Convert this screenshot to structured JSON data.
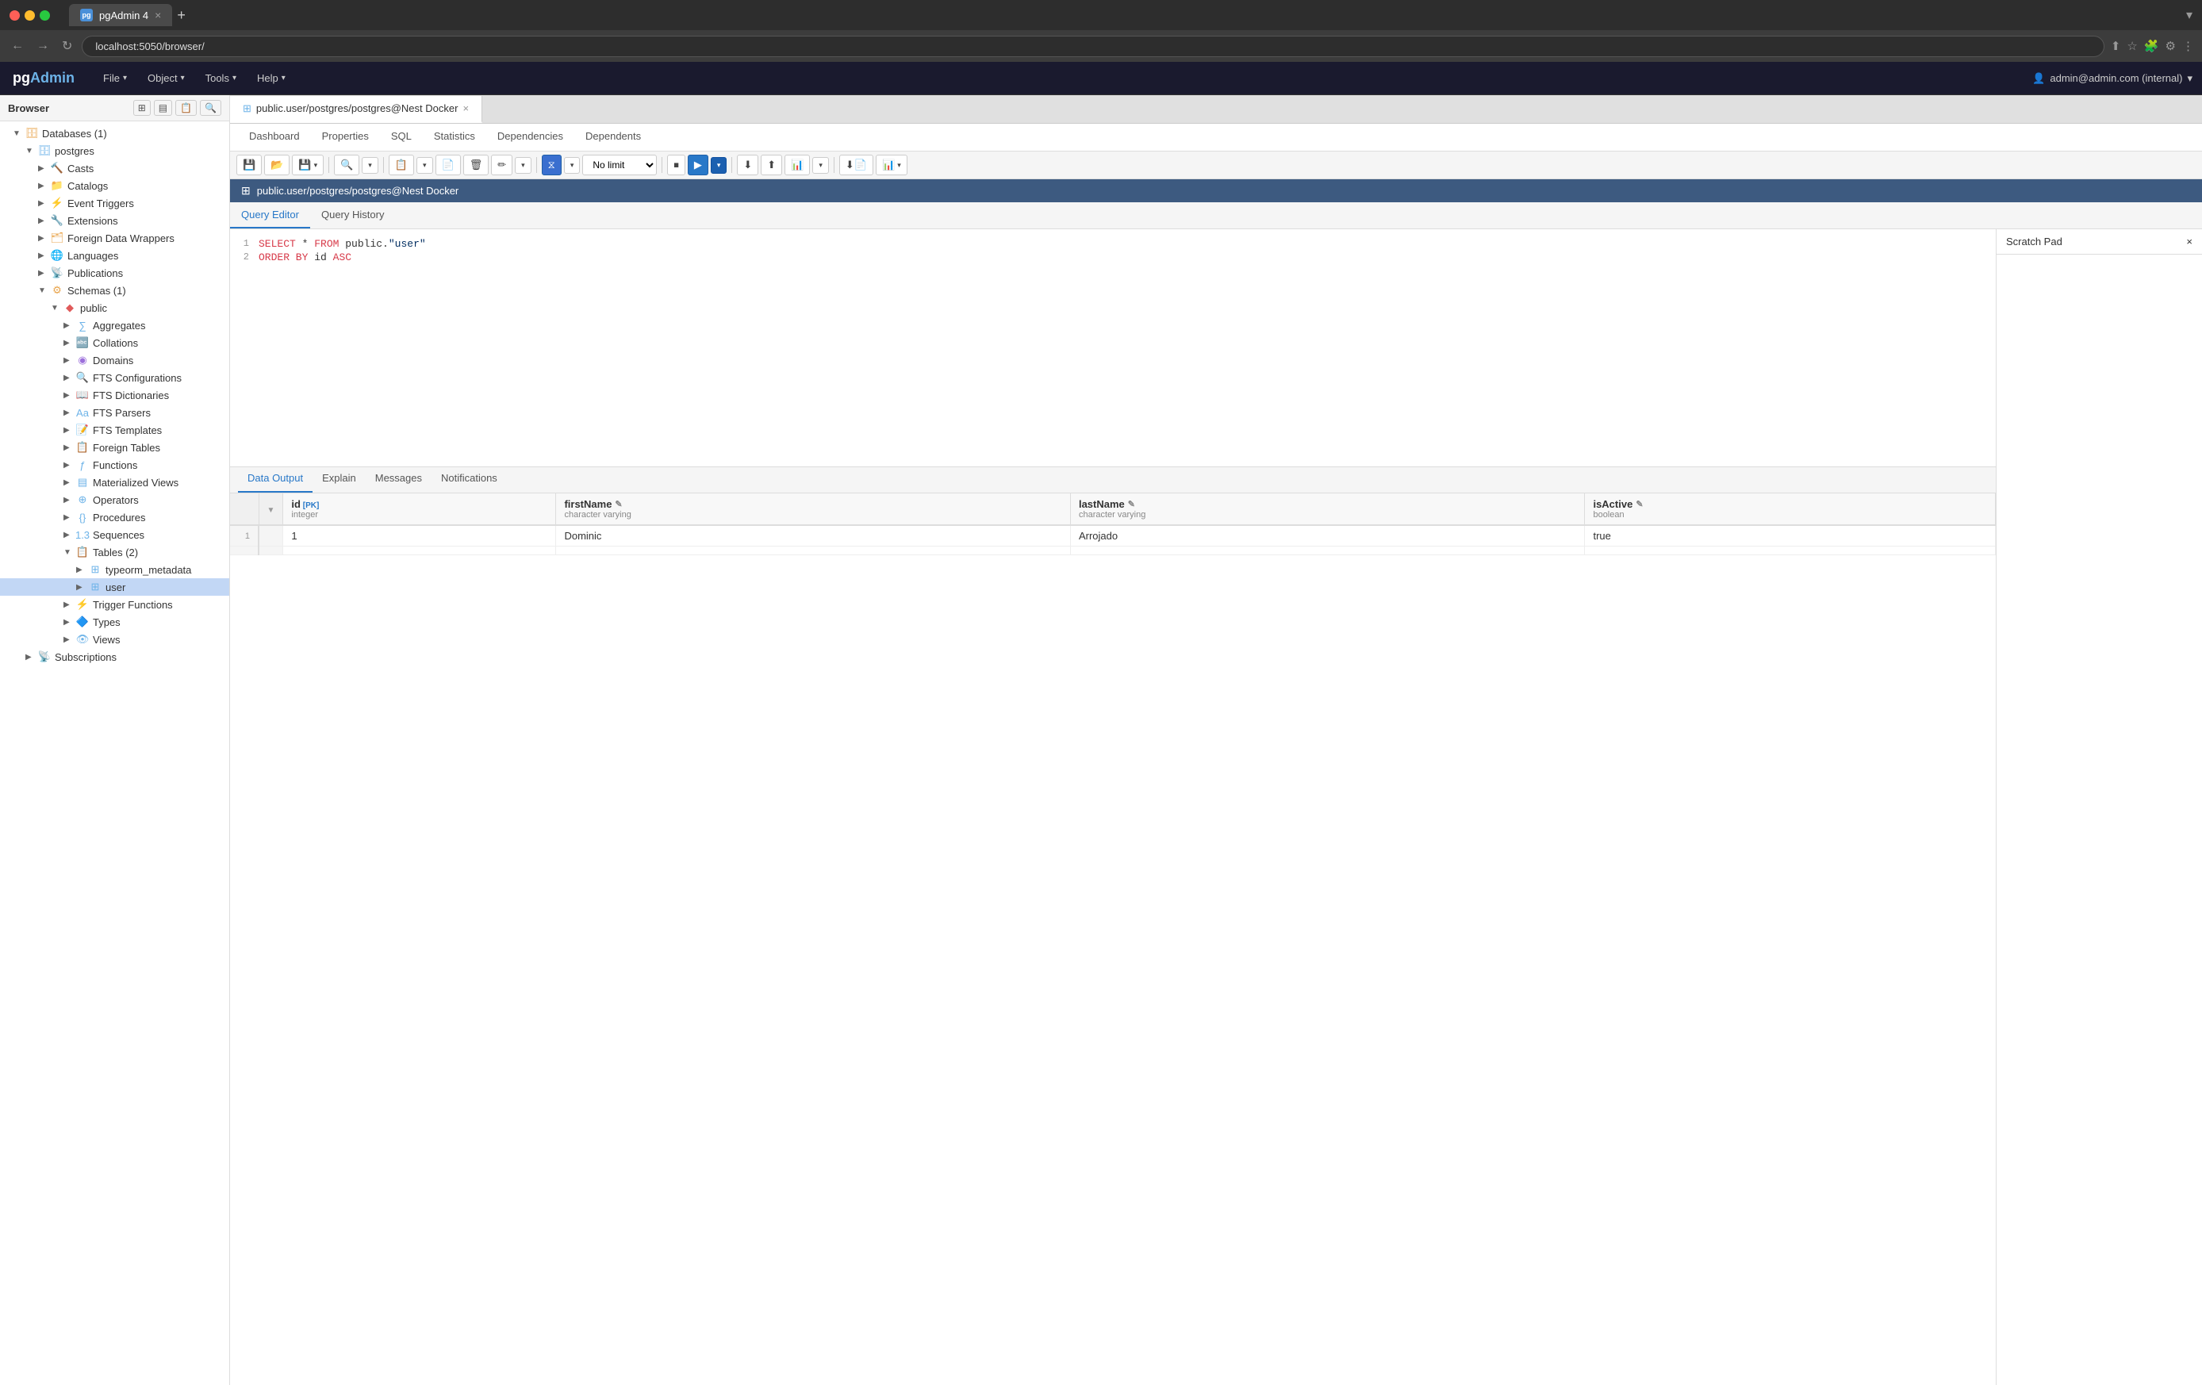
{
  "titlebar": {
    "tab_icon": "pg",
    "tab_title": "pgAdmin 4",
    "new_tab_label": "+",
    "window_controls": "▾"
  },
  "addressbar": {
    "url": "localhost:5050/browser/",
    "back": "←",
    "forward": "→",
    "refresh": "↻"
  },
  "app_header": {
    "logo": "pgAdmin",
    "menus": [
      {
        "label": "File",
        "has_arrow": true
      },
      {
        "label": "Object",
        "has_arrow": true
      },
      {
        "label": "Tools",
        "has_arrow": true
      },
      {
        "label": "Help",
        "has_arrow": true
      }
    ],
    "user": "admin@admin.com (internal)",
    "user_arrow": "▾"
  },
  "browser": {
    "title": "Browser",
    "toolbar_buttons": [
      "⊞",
      "▤",
      "📋",
      "🔍"
    ],
    "tree": [
      {
        "indent": 1,
        "toggle": "▼",
        "icon": "🗄",
        "icon_color": "#e8a44b",
        "label": "Databases (1)",
        "level": 1
      },
      {
        "indent": 2,
        "toggle": "▼",
        "icon": "🗄",
        "icon_color": "#6db3e8",
        "label": "postgres",
        "level": 2
      },
      {
        "indent": 3,
        "toggle": "▶",
        "icon": "🔨",
        "icon_color": "#e8a44b",
        "label": "Casts",
        "level": 3
      },
      {
        "indent": 3,
        "toggle": "▶",
        "icon": "📁",
        "icon_color": "#e8c860",
        "label": "Catalogs",
        "level": 3
      },
      {
        "indent": 3,
        "toggle": "▶",
        "icon": "⚡",
        "icon_color": "#9c6fdb",
        "label": "Event Triggers",
        "level": 3
      },
      {
        "indent": 3,
        "toggle": "▶",
        "icon": "🔧",
        "icon_color": "#6db3e8",
        "label": "Extensions",
        "level": 3
      },
      {
        "indent": 3,
        "toggle": "▶",
        "icon": "🗂",
        "icon_color": "#e8a44b",
        "label": "Foreign Data Wrappers",
        "level": 3
      },
      {
        "indent": 3,
        "toggle": "▶",
        "icon": "🌐",
        "icon_color": "#6db3e8",
        "label": "Languages",
        "level": 3
      },
      {
        "indent": 3,
        "toggle": "▶",
        "icon": "📡",
        "icon_color": "#6db3e8",
        "label": "Publications",
        "level": 3
      },
      {
        "indent": 3,
        "toggle": "▼",
        "icon": "⚙",
        "icon_color": "#e8a44b",
        "label": "Schemas (1)",
        "level": 3
      },
      {
        "indent": 4,
        "toggle": "▼",
        "icon": "◆",
        "icon_color": "#e05a5a",
        "label": "public",
        "level": 4
      },
      {
        "indent": 5,
        "toggle": "▶",
        "icon": "∑",
        "icon_color": "#6db3e8",
        "label": "Aggregates",
        "level": 5
      },
      {
        "indent": 5,
        "toggle": "▶",
        "icon": "🔤",
        "icon_color": "#e8a44b",
        "label": "Collations",
        "level": 5
      },
      {
        "indent": 5,
        "toggle": "▶",
        "icon": "◉",
        "icon_color": "#9c6fdb",
        "label": "Domains",
        "level": 5
      },
      {
        "indent": 5,
        "toggle": "▶",
        "icon": "🔍",
        "icon_color": "#6db3e8",
        "label": "FTS Configurations",
        "level": 5
      },
      {
        "indent": 5,
        "toggle": "▶",
        "icon": "📖",
        "icon_color": "#6db3e8",
        "label": "FTS Dictionaries",
        "level": 5
      },
      {
        "indent": 5,
        "toggle": "▶",
        "icon": "Aa",
        "icon_color": "#6db3e8",
        "label": "FTS Parsers",
        "level": 5
      },
      {
        "indent": 5,
        "toggle": "▶",
        "icon": "📝",
        "icon_color": "#6db3e8",
        "label": "FTS Templates",
        "level": 5
      },
      {
        "indent": 5,
        "toggle": "▶",
        "icon": "📋",
        "icon_color": "#6db3e8",
        "label": "Foreign Tables",
        "level": 5
      },
      {
        "indent": 5,
        "toggle": "▶",
        "icon": "ƒ",
        "icon_color": "#6db3e8",
        "label": "Functions",
        "level": 5
      },
      {
        "indent": 5,
        "toggle": "▶",
        "icon": "▤",
        "icon_color": "#6db3e8",
        "label": "Materialized Views",
        "level": 5
      },
      {
        "indent": 5,
        "toggle": "▶",
        "icon": "⊕",
        "icon_color": "#6db3e8",
        "label": "Operators",
        "level": 5
      },
      {
        "indent": 5,
        "toggle": "▶",
        "icon": "{}",
        "icon_color": "#6db3e8",
        "label": "Procedures",
        "level": 5
      },
      {
        "indent": 5,
        "toggle": "▶",
        "icon": "1.3",
        "icon_color": "#6db3e8",
        "label": "Sequences",
        "level": 5
      },
      {
        "indent": 5,
        "toggle": "▼",
        "icon": "📋",
        "icon_color": "#6db3e8",
        "label": "Tables (2)",
        "level": 5
      },
      {
        "indent": 6,
        "toggle": "▶",
        "icon": "⊞",
        "icon_color": "#6db3e8",
        "label": "typeorm_metadata",
        "level": 6
      },
      {
        "indent": 6,
        "toggle": "▶",
        "icon": "⊞",
        "icon_color": "#6db3e8",
        "label": "user",
        "level": 6,
        "selected": true
      },
      {
        "indent": 5,
        "toggle": "▶",
        "icon": "⚡",
        "icon_color": "#9c6fdb",
        "label": "Trigger Functions",
        "level": 5
      },
      {
        "indent": 5,
        "toggle": "▶",
        "icon": "🔷",
        "icon_color": "#6db3e8",
        "label": "Types",
        "level": 5
      },
      {
        "indent": 5,
        "toggle": "▶",
        "icon": "👁",
        "icon_color": "#6db3e8",
        "label": "Views",
        "level": 5
      },
      {
        "indent": 2,
        "toggle": "▶",
        "icon": "📡",
        "icon_color": "#9c6fdb",
        "label": "Subscriptions",
        "level": 2
      }
    ]
  },
  "content_tab": {
    "label": "public.user/postgres/postgres@Nest Docker",
    "icon": "⊞",
    "close": "×"
  },
  "nav_tabs": [
    {
      "label": "Dashboard"
    },
    {
      "label": "Properties"
    },
    {
      "label": "SQL"
    },
    {
      "label": "Statistics"
    },
    {
      "label": "Dependencies"
    },
    {
      "label": "Dependents"
    }
  ],
  "active_content_tab": "public.user/postgres/postgres@Nest Docker",
  "query_tabs": [
    {
      "label": "Query Editor",
      "active": true
    },
    {
      "label": "Query History"
    }
  ],
  "breadcrumb": "public.user/postgres/postgres@Nest Docker",
  "toolbar": {
    "buttons": [
      {
        "icon": "💾",
        "title": "Save"
      },
      {
        "icon": "📂",
        "title": "Open"
      },
      {
        "icon": "💾▾",
        "title": "Save file"
      },
      {
        "icon": "|"
      },
      {
        "icon": "🔍",
        "title": "Find"
      },
      {
        "icon": "▾",
        "title": "Find options"
      },
      {
        "icon": "|"
      },
      {
        "icon": "📋",
        "title": "Copy"
      },
      {
        "icon": "▾",
        "title": "Copy options"
      },
      {
        "icon": "📄",
        "title": "Paste"
      },
      {
        "icon": "🗑",
        "title": "Delete"
      },
      {
        "icon": "✏",
        "title": "Edit"
      },
      {
        "icon": "▾",
        "title": "Edit options"
      },
      {
        "icon": "|"
      },
      {
        "icon": "🔽",
        "title": "Filter",
        "active": true
      },
      {
        "icon": "▾",
        "title": "Filter options"
      },
      {
        "icon": "no_limit",
        "type": "select"
      },
      {
        "icon": "|"
      },
      {
        "icon": "⏹",
        "title": "Stop"
      },
      {
        "icon": "▶",
        "title": "Run"
      },
      {
        "icon": "▾",
        "title": "Run options"
      },
      {
        "icon": "|"
      },
      {
        "icon": "⬇",
        "title": "Download"
      },
      {
        "icon": "⬆",
        "title": "Upload"
      },
      {
        "icon": "🔄",
        "title": "Refresh"
      },
      {
        "icon": "⟲",
        "title": "Reset"
      },
      {
        "icon": "|"
      },
      {
        "icon": "⬇",
        "title": "Export"
      },
      {
        "icon": "📊",
        "title": "View data"
      },
      {
        "icon": "▾",
        "title": "View data options"
      }
    ],
    "no_limit_label": "No limit"
  },
  "code": {
    "lines": [
      {
        "num": 1,
        "tokens": [
          {
            "text": "SELECT",
            "type": "kw"
          },
          {
            "text": " * ",
            "type": "id"
          },
          {
            "text": "FROM",
            "type": "kw"
          },
          {
            "text": " public.",
            "type": "id"
          },
          {
            "text": "\"user\"",
            "type": "str"
          }
        ]
      },
      {
        "num": 2,
        "tokens": [
          {
            "text": "ORDER BY",
            "type": "kw"
          },
          {
            "text": " id ",
            "type": "id"
          },
          {
            "text": "ASC",
            "type": "kw"
          }
        ]
      }
    ]
  },
  "scratch_pad": {
    "title": "Scratch Pad",
    "close": "×"
  },
  "results": {
    "tabs": [
      {
        "label": "Data Output",
        "active": true
      },
      {
        "label": "Explain"
      },
      {
        "label": "Messages"
      },
      {
        "label": "Notifications"
      }
    ],
    "columns": [
      {
        "name": "id",
        "badge": "[PK]",
        "type": "integer",
        "has_sort": true
      },
      {
        "name": "firstName",
        "type": "character varying",
        "edit": true
      },
      {
        "name": "lastName",
        "type": "character varying",
        "edit": true
      },
      {
        "name": "isActive",
        "type": "boolean",
        "edit": true
      }
    ],
    "rows": [
      {
        "row_num": 1,
        "id": "1",
        "firstName": "Dominic",
        "lastName": "Arrojado",
        "isActive": "true"
      },
      {
        "row_num": "",
        "id": "",
        "firstName": "",
        "lastName": "",
        "isActive": ""
      }
    ]
  }
}
